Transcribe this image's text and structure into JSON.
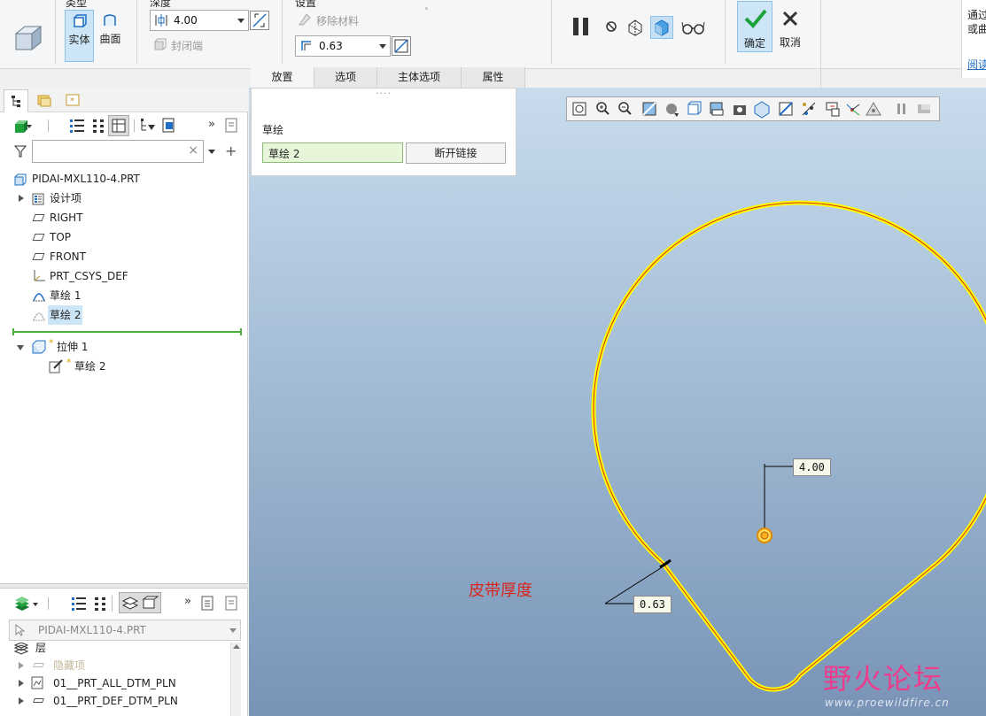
{
  "ribbon": {
    "type_group_label": "类型",
    "solid_label": "实体",
    "surface_label": "曲面",
    "depth_group_label": "深度",
    "depth_value": "4.00",
    "capped_ends_label": "封闭端",
    "settings_group_label": "设置",
    "remove_material_label": "移除材料",
    "thickness_value": "0.63",
    "ok_label": "确定",
    "cancel_label": "取消",
    "side_text_1": "通过",
    "side_text_2": "或曲",
    "side_link": "阅读"
  },
  "tabs": [
    {
      "label": "放置",
      "active": true
    },
    {
      "label": "选项",
      "active": false
    },
    {
      "label": "主体选项",
      "active": false
    },
    {
      "label": "属性",
      "active": false
    }
  ],
  "placement": {
    "drag_handle": "....",
    "section_label": "草绘",
    "sketch_value": "草绘 2",
    "unlink_label": "断开链接"
  },
  "model_tree": {
    "search_placeholder": "",
    "items": [
      {
        "label": "PIDAI-MXL110-4.PRT",
        "icon": "part-icon"
      },
      {
        "label": "设计项",
        "icon": "design-items-icon"
      },
      {
        "label": "RIGHT",
        "icon": "datum-plane-icon"
      },
      {
        "label": "TOP",
        "icon": "datum-plane-icon"
      },
      {
        "label": "FRONT",
        "icon": "datum-plane-icon"
      },
      {
        "label": "PRT_CSYS_DEF",
        "icon": "csys-icon"
      },
      {
        "label": "草绘 1",
        "icon": "sketch-icon"
      },
      {
        "label": "草绘 2",
        "icon": "sketch-icon"
      },
      {
        "label": "拉伸 1",
        "icon": "extrude-icon",
        "prefix": "*"
      },
      {
        "label": "草绘 2",
        "icon": "sketch-edit-icon",
        "prefix": "*"
      }
    ]
  },
  "layer_tree": {
    "model_name": "PIDAI-MXL110-4.PRT",
    "root_label": "层",
    "items": [
      {
        "label": "隐藏项",
        "dim": true
      },
      {
        "label": "01__PRT_ALL_DTM_PLN"
      },
      {
        "label": "01__PRT_DEF_DTM_PLN"
      }
    ]
  },
  "graphics": {
    "dim_depth": "4.00",
    "dim_thickness": "0.63",
    "annotation": "皮带厚度",
    "watermark_title": "野火论坛",
    "watermark_url": "www.proewildfire.cn"
  },
  "colors": {
    "accent_blue": "#1e6fc4",
    "selection_yellow": "#ffff00",
    "annotation_red": "#d9261c",
    "ok_green": "#1ea33c"
  }
}
